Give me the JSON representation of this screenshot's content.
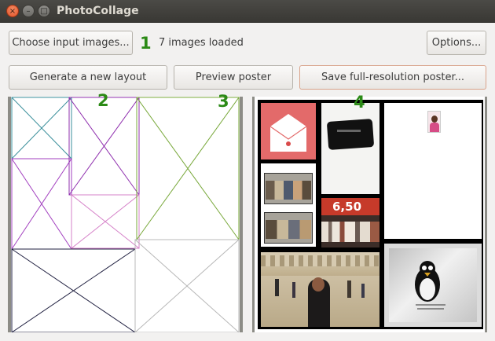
{
  "window": {
    "title": "PhotoCollage",
    "close_glyph": "×",
    "minimize_glyph": "–",
    "maximize_glyph": "□"
  },
  "toolbar": {
    "choose_label": "Choose input images...",
    "status": "7 images loaded",
    "options_label": "Options...",
    "generate_label": "Generate a new layout",
    "preview_label": "Preview poster",
    "save_label": "Save full-resolution poster..."
  },
  "markers": [
    "1",
    "2",
    "3",
    "4"
  ],
  "colors": {
    "marker": "#2b8a16",
    "layout_teal": "#3a8f9b",
    "layout_purple": "#a23fbf",
    "layout_green": "#78a83a",
    "layout_gray": "#b8b8b8",
    "layout_navy": "#202040",
    "layout_pink": "#d580c8"
  },
  "poster": {
    "tiles": [
      {
        "name": "red-envelope-image",
        "text": ""
      },
      {
        "name": "black-tape-image",
        "text": ""
      },
      {
        "name": "profile-photo-image",
        "text": ""
      },
      {
        "name": "comic-strip-image",
        "text": ""
      },
      {
        "name": "price-sign-image",
        "text": "6,50"
      },
      {
        "name": "palace-portrait-image",
        "text": ""
      },
      {
        "name": "linux-penguin-cloth-image",
        "text": ""
      }
    ]
  }
}
